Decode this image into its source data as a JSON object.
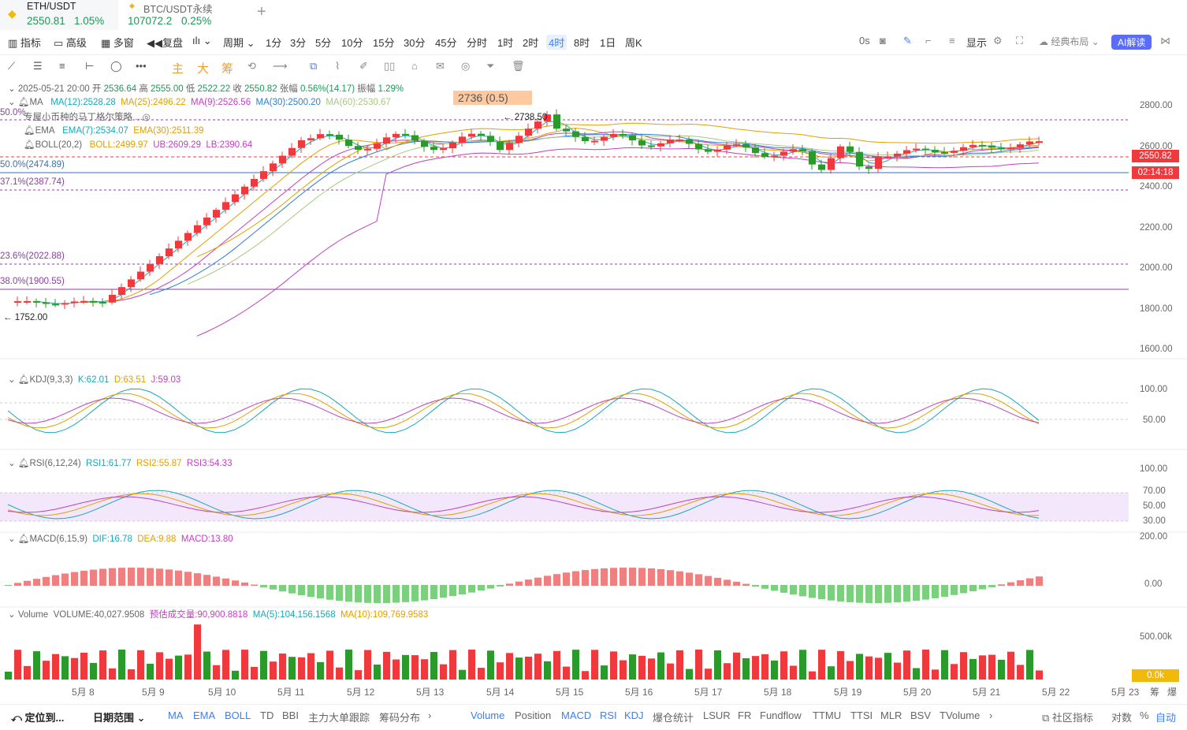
{
  "tabs": [
    {
      "symbol": "ETH/USDT",
      "price": "2550.81",
      "change": "1.05%"
    },
    {
      "symbol": "BTC/USDT永续",
      "price": "107072.2",
      "change": "0.25%"
    }
  ],
  "toolbar": {
    "indicator": "指标",
    "advanced": "高级",
    "multi_window": "多窗",
    "replay": "复盘",
    "period": "周期",
    "periods": [
      "1分",
      "3分",
      "5分",
      "10分",
      "15分",
      "30分",
      "45分",
      "分时",
      "1时",
      "2时",
      "4时",
      "8时",
      "1日",
      "周K"
    ],
    "active_period": "4时",
    "countdown": "0s",
    "display": "显示",
    "layout": "经典布局",
    "ai_label": "AI解读"
  },
  "drawbar": {
    "labels": [
      "主",
      "大",
      "筹"
    ]
  },
  "ohlc_line": {
    "date": "2025-05-21 20:00",
    "open_label": "开",
    "open": "2536.64",
    "high_label": "高",
    "high": "2555.00",
    "low_label": "低",
    "low": "2522.22",
    "close_label": "收",
    "close": "2550.82",
    "change_label": "张幅",
    "change": "0.56%(14.17)",
    "amp_label": "振幅",
    "amp": "1.29%"
  },
  "ma_line": {
    "name": "MA",
    "ma12": "MA(12):2528.28",
    "ma25": "MA(25):2496.22",
    "ma9": "MA(9):2526.56",
    "ma30": "MA(30):2500.20",
    "ma60": "MA(60):2530.67"
  },
  "strategy_note": "专屋小币种的马丁格尔策略",
  "ema_line": {
    "name": "EMA",
    "ema7": "EMA(7):2534.07",
    "ema30": "EMA(30):2511.39"
  },
  "boll_line": {
    "name": "BOLL(20,2)",
    "boll": "BOLL:2499.97",
    "ub": "UB:2609.29",
    "lb": "LB:2390.64"
  },
  "price_box": "2736  (0.5)",
  "high_marker": "2738.50",
  "low_marker": "1752.00",
  "fib": [
    "50.0%(2474.89)",
    "37.1%(2387.74)",
    "23.6%(2022.88)",
    "38.0%(1900.55)",
    "50.0%"
  ],
  "price_axis": [
    "2800.00",
    "2600.00",
    "2400.00",
    "2200.00",
    "2000.00",
    "1800.00",
    "1600.00"
  ],
  "current_price": "2550.82",
  "countdown_tag": "02:14:18",
  "kdj": {
    "name": "KDJ(9,3,3)",
    "k": "K:62.01",
    "d": "D:63.51",
    "j": "J:59.03",
    "axis": [
      "100.00",
      "50.00"
    ]
  },
  "rsi": {
    "name": "RSI(6,12,24)",
    "r1": "RSI1:61.77",
    "r2": "RSI2:55.87",
    "r3": "RSI3:54.33",
    "axis": [
      "100.00",
      "70.00",
      "50.00",
      "30.00"
    ]
  },
  "macd": {
    "name": "MACD(6,15,9)",
    "dif": "DIF:16.78",
    "dea": "DEA:9.88",
    "macd": "MACD:13.80",
    "axis": [
      "200.00",
      "0.00"
    ]
  },
  "volume": {
    "name": "Volume",
    "vol": "VOLUME:40,027.9508",
    "est": "预估成交量:90,900.8818",
    "ma5": "MA(5):104,156.1568",
    "ma10": "MA(10):109,769.9583",
    "axis": [
      "500.00k",
      "0.0k"
    ]
  },
  "x_axis": [
    "5月 8",
    "5月 9",
    "5月 10",
    "5月 11",
    "5月 12",
    "5月 13",
    "5月 14",
    "5月 15",
    "5月 16",
    "5月 17",
    "5月 18",
    "5月 19",
    "5月 20",
    "5月 21",
    "5月 22",
    "5月 23"
  ],
  "x_axis_tail": [
    "筹",
    "爆"
  ],
  "bottombar": {
    "locate": "定位到...",
    "date_range": "日期范围",
    "main_inds": [
      "MA",
      "EMA",
      "BOLL",
      "TD",
      "BBI",
      "主力大单跟踪",
      "筹码分布"
    ],
    "sub_inds": [
      "Volume",
      "Position",
      "MACD",
      "RSI",
      "KDJ",
      "爆仓统计",
      "LSUR",
      "FR",
      "Fundflow",
      "TTMU",
      "TTSI",
      "MLR",
      "BSV",
      "TVolume"
    ],
    "community": "社区指标",
    "log": "对数",
    "pct": "%",
    "auto": "自动"
  },
  "colors": {
    "up": "#f0393d",
    "down": "#2a9a2a",
    "accent": "#3b7ff5",
    "boll_band": "#f2e7fb",
    "price_tag": "#f0393d",
    "countdown_tag": "#f0393d"
  }
}
